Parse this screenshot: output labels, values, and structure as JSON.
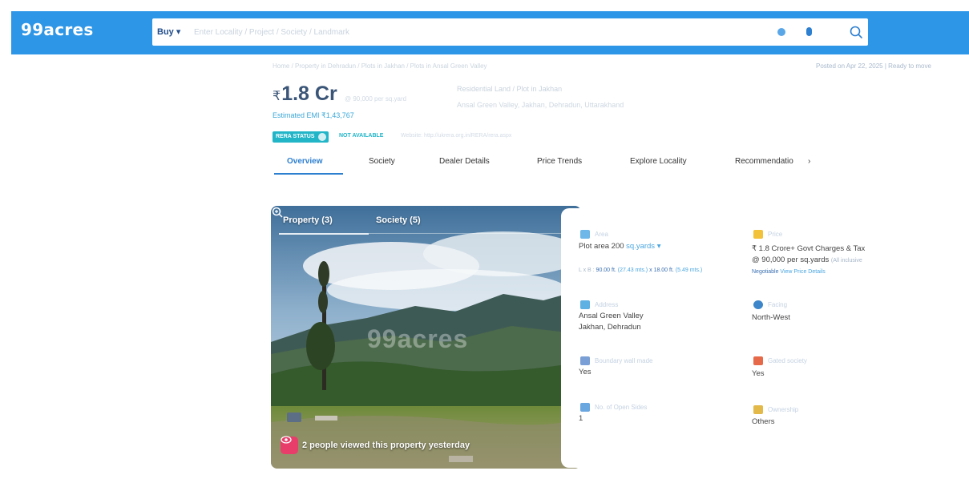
{
  "header": {
    "logo": "99acres",
    "search_mode": "Buy",
    "search_placeholder": "Enter Locality / Project / Society / Landmark",
    "colors": {
      "bar": "#2d96e6",
      "accent": "#2d7fd0"
    },
    "icons": [
      "location-icon",
      "mic-icon",
      "search-icon"
    ]
  },
  "listing": {
    "breadcrumb": "Home / Property in Dehradun / Plots in Jakhan / Plots in Ansal Green Valley",
    "posted": "Posted on Apr 22, 2025  |  Ready to move",
    "price_symbol": "₹",
    "price_value": "1.8 Cr",
    "price_sub": "@ 90,000 per sq.yard",
    "title_line1": "Residential Land / Plot in Jakhan",
    "title_line2": "Ansal Green Valley, Jakhan, Dehradun, Uttarakhand",
    "emi": "Estimated EMI ₹1,43,767",
    "rera_status": "RERA STATUS",
    "rera_value": "NOT AVAILABLE",
    "rera_website": "Website: http://ukrera.org.in/RERA/rera.aspx"
  },
  "tabs": [
    {
      "label": "Overview",
      "active": true
    },
    {
      "label": "Society",
      "active": false
    },
    {
      "label": "Dealer Details",
      "active": false
    },
    {
      "label": "Price Trends",
      "active": false
    },
    {
      "label": "Explore Locality",
      "active": false
    },
    {
      "label": "Recommendatio",
      "active": false
    }
  ],
  "tabs_next_icon": "chevron-right-icon",
  "gallery": {
    "tab_property": "Property (3)",
    "tab_society": "Society (5)",
    "views_text": "2 people viewed this property yesterday",
    "watermark": "99acres"
  },
  "details": {
    "area": {
      "label": "Area",
      "value": "Plot area 200",
      "unit": "sq.yards",
      "dims_prefix": "L x B :",
      "dims_length": "90.00 ft.",
      "dims_length_m": "(27.43 mts.)",
      "dims_x": "x",
      "dims_breadth": "18.00 ft.",
      "dims_breadth_m": "(5.49 mts.)"
    },
    "price": {
      "label": "Price",
      "value": "₹ 1.8 Crore+ Govt Charges & Tax",
      "rate": "@ 90,000 per sq.yards",
      "rate_note": "(All inclusive",
      "negotiable": "Negotiable",
      "view_details": "View Price Details"
    },
    "address": {
      "label": "Address",
      "line1": "Ansal Green Valley",
      "line2": "Jakhan, Dehradun"
    },
    "facing": {
      "label": "Facing",
      "value": "North-West"
    },
    "boundary": {
      "label": "Boundary wall made",
      "value": "Yes"
    },
    "gated": {
      "label": "Gated society",
      "value": "Yes"
    },
    "open_sides": {
      "label": "No. of Open Sides",
      "value": "1"
    },
    "ownership": {
      "label": "Ownership",
      "value": "Others"
    }
  }
}
